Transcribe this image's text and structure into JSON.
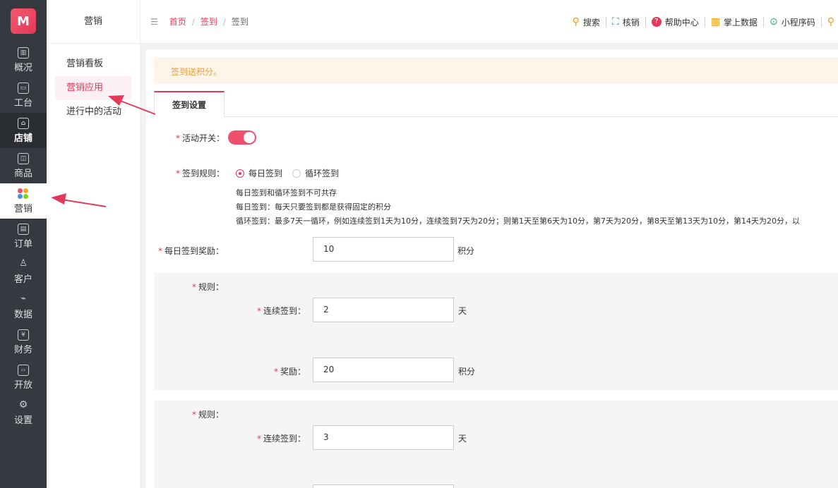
{
  "leftnav": {
    "logo": "M",
    "items": [
      {
        "label": "概况",
        "icon": "overview-icon",
        "glyph": "▥"
      },
      {
        "label": "工台",
        "icon": "monitor-icon",
        "glyph": "▭"
      },
      {
        "label": "店铺",
        "icon": "store-icon",
        "glyph": "⌂"
      },
      {
        "label": "商品",
        "icon": "bag-icon",
        "glyph": "◫"
      },
      {
        "label": "营销",
        "icon": "marketing-icon",
        "glyph": ""
      },
      {
        "label": "订单",
        "icon": "order-icon",
        "glyph": "▤"
      },
      {
        "label": "客户",
        "icon": "customer-icon",
        "glyph": "♙"
      },
      {
        "label": "数据",
        "icon": "data-icon",
        "glyph": "⌁"
      },
      {
        "label": "财务",
        "icon": "finance-icon",
        "glyph": "¥"
      },
      {
        "label": "开放",
        "icon": "open-icon",
        "glyph": "‹›"
      },
      {
        "label": "设置",
        "icon": "settings-icon",
        "glyph": "⚙"
      }
    ]
  },
  "subnav": {
    "title": "营销",
    "items": [
      "营销看板",
      "营销应用",
      "进行中的活动"
    ]
  },
  "header": {
    "breadcrumb": [
      "首页",
      "签到",
      "签到"
    ],
    "tools": [
      {
        "label": "搜索",
        "icon": "search-icon",
        "glyph": "⚲",
        "color": "#f39c12"
      },
      {
        "label": "核销",
        "icon": "scan-icon",
        "glyph": "⛶",
        "color": "#3a7bd5"
      },
      {
        "label": "帮助中心",
        "icon": "help-icon",
        "glyph": "?",
        "color": "#e33a5a"
      },
      {
        "label": "掌上数据",
        "icon": "chart-icon",
        "glyph": "▥",
        "color": "#f39c12"
      },
      {
        "label": "小程序码",
        "icon": "miniapp-icon",
        "glyph": "⊙",
        "color": "#27ae60"
      }
    ]
  },
  "notice": "签到送积分。",
  "tab": "签到设置",
  "form": {
    "switch_label": "活动开关：",
    "rule_label": "签到规则：",
    "radio_daily": "每日签到",
    "radio_cycle": "循环签到",
    "desc1": "每日签到和循环签到不可共存",
    "desc2": "每日签到：每天只要签到都是获得固定的积分",
    "desc3": "循环签到：最多7天一循环，例如连续签到1天为10分，连续签到7天为20分；则第1天至第6天为10分，第7天为20分，第8天至第13天为10分，第14天为20分，以",
    "daily_reward_label": "每日签到奖励：",
    "daily_reward_value": "10",
    "points_unit": "积分",
    "rules": [
      {
        "rule_label": "规则：",
        "days_label": "连续签到：",
        "days_value": "2",
        "days_unit": "天",
        "reward_label": "奖励：",
        "reward_value": "20",
        "reward_unit": "积分"
      },
      {
        "rule_label": "规则：",
        "days_label": "连续签到：",
        "days_value": "3",
        "days_unit": "天"
      }
    ]
  },
  "colors": {
    "accent": "#e33a5a",
    "notice_text": "#e8a13d",
    "nav_bg": "#363a40"
  }
}
